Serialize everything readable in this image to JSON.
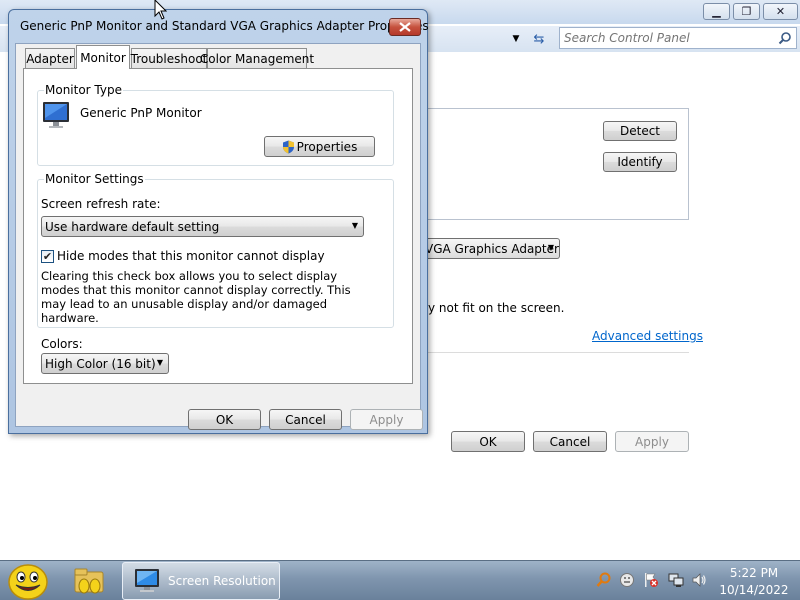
{
  "control_panel": {
    "search_placeholder": "Search Control Panel",
    "detect_label": "Detect",
    "identify_label": "Identify",
    "display_select_text": "VGA Graphics Adapter",
    "fit_text": "y not fit on the screen.",
    "advanced_link": "Advanced settings",
    "ok_label": "OK",
    "cancel_label": "Cancel",
    "apply_label": "Apply",
    "min_glyph": "▁",
    "max_glyph": "❐",
    "close_glyph": "✕"
  },
  "dialog": {
    "title": "Generic PnP Monitor and Standard VGA Graphics Adapter Properties",
    "tabs": [
      {
        "label": "Adapter"
      },
      {
        "label": "Monitor"
      },
      {
        "label": "Troubleshoot"
      },
      {
        "label": "Color Management"
      }
    ],
    "active_tab": "Monitor",
    "monitor_type": {
      "group_label": "Monitor Type",
      "monitor_name": "Generic PnP Monitor",
      "properties_button": "Properties"
    },
    "monitor_settings": {
      "group_label": "Monitor Settings",
      "refresh_label": "Screen refresh rate:",
      "refresh_value": "Use hardware default setting",
      "hide_modes_label": "Hide modes that this monitor cannot display",
      "hide_modes_checked": true,
      "hide_modes_description": "Clearing this check box allows you to select display modes that this monitor cannot display correctly. This may lead to an unusable display and/or damaged hardware."
    },
    "colors": {
      "label": "Colors:",
      "value": "High Color (16 bit)"
    },
    "ok_label": "OK",
    "cancel_label": "Cancel",
    "apply_label": "Apply"
  },
  "taskbar": {
    "task_label": "Screen Resolution",
    "clock_time": "5:22 PM",
    "clock_date": "10/14/2022"
  },
  "colors": {
    "link": "#0066cc",
    "dialog_frame": "#aec5e2",
    "taskbar": "#7f95ae"
  }
}
